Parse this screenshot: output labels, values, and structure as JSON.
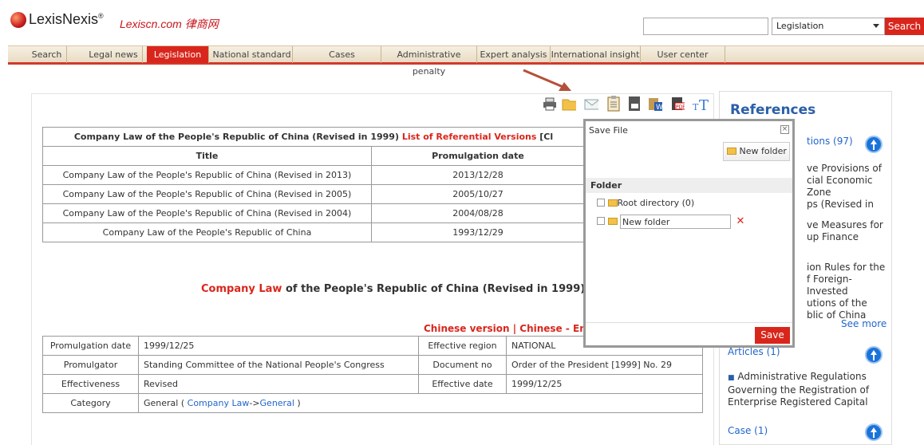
{
  "header": {
    "brand": "LexisNexis",
    "brand_mark": "®",
    "subbrand": "Lexiscn.com 律商网",
    "search_placeholder": "",
    "search_scope": "Legislation",
    "search_button": "Search"
  },
  "nav": {
    "items": [
      "Search",
      "Legal news",
      "Legislation",
      "National standard",
      "Cases",
      "Administrative penalty",
      "Expert analysis",
      "International insight",
      "User center"
    ],
    "active": "Legislation"
  },
  "toolbar": {
    "icons": [
      "print-icon",
      "folder-icon",
      "email-icon",
      "clipboard-icon",
      "txt-export-icon",
      "word-export-icon",
      "pdf-export-icon",
      "font-size-icon"
    ]
  },
  "versions": {
    "heading_prefix": "Company Law of the People's Republic of China (Revised in 1999)",
    "heading_link": "List of Referential Versions",
    "heading_tail": "[Cl",
    "col_title": "Title",
    "col_date": "Promulgation date",
    "rows": [
      {
        "title": "Company Law of the People's Republic of China (Revised in 2013)",
        "date": "2013/12/28"
      },
      {
        "title": "Company Law of the People's Republic of China (Revised in 2005)",
        "date": "2005/10/27"
      },
      {
        "title": "Company Law of the People's Republic of China (Revised in 2004)",
        "date": "2004/08/28"
      },
      {
        "title": "Company Law of the People's Republic of China",
        "date": "1993/12/29"
      }
    ]
  },
  "doc": {
    "title_red": "Company Law",
    "title_rest": "of the People's Republic of China (Revised in 1999)",
    "lang_links": "Chinese version | Chinese - English"
  },
  "meta": {
    "promulgation_date_label": "Promulgation date",
    "promulgation_date": "1999/12/25",
    "effective_region_label": "Effective region",
    "effective_region": "NATIONAL",
    "promulgator_label": "Promulgator",
    "promulgator": "Standing Committee of the National People's Congress",
    "document_no_label": "Document no",
    "document_no": "Order of the President [1999] No. 29",
    "effectiveness_label": "Effectiveness",
    "effectiveness": "Revised",
    "effective_date_label": "Effective date",
    "effective_date": "1999/12/25",
    "category_label": "Category",
    "category_prefix": "General (",
    "category_link1": "Company Law",
    "category_arrow": "->",
    "category_link2": "General",
    "category_suffix": ")"
  },
  "dialog": {
    "title": "Save File",
    "new_folder_button": "New folder",
    "folder_heading": "Folder",
    "folders": [
      {
        "label": "Root directory (0)"
      },
      {
        "label": "New folder",
        "editing": true
      }
    ],
    "save_button": "Save"
  },
  "sidebar": {
    "title": "References",
    "section1_tail": "tions (97)",
    "item1": [
      "ve Provisions of",
      "cial Economic Zone",
      "ps (Revised in"
    ],
    "item2": [
      "ve Measures for",
      "up Finance"
    ],
    "item3": [
      "ion Rules for the",
      "f Foreign-Invested",
      "utions of the",
      "blic of China"
    ],
    "see_more": "See more",
    "articles": "Articles (1)",
    "article_item": "Administrative Regulations Governing the Registration of Enterprise Registered Capital",
    "case": "Case (1)"
  },
  "colors": {
    "accent_red": "#d9261c",
    "link_blue": "#2266cc",
    "arrow": "#b4503a"
  }
}
